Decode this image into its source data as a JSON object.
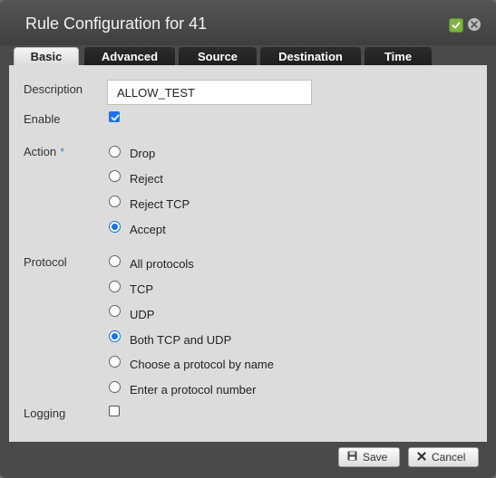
{
  "window": {
    "title": "Rule Configuration for 41",
    "apply_icon": "check-icon",
    "close_icon": "close-icon"
  },
  "tabs": [
    {
      "label": "Basic",
      "active": true
    },
    {
      "label": "Advanced",
      "active": false
    },
    {
      "label": "Source",
      "active": false
    },
    {
      "label": "Destination",
      "active": false
    },
    {
      "label": "Time",
      "active": false
    }
  ],
  "form": {
    "description": {
      "label": "Description",
      "value": "ALLOW_TEST"
    },
    "enable": {
      "label": "Enable",
      "checked": true
    },
    "action": {
      "label": "Action",
      "required_mark": "*",
      "options": [
        "Drop",
        "Reject",
        "Reject TCP",
        "Accept"
      ],
      "selected": "Accept"
    },
    "protocol": {
      "label": "Protocol",
      "options": [
        "All protocols",
        "TCP",
        "UDP",
        "Both TCP and UDP",
        "Choose a protocol by name",
        "Enter a protocol number"
      ],
      "selected": "Both TCP and UDP"
    },
    "logging": {
      "label": "Logging",
      "checked": false
    }
  },
  "footer": {
    "save_label": "Save",
    "cancel_label": "Cancel"
  },
  "colors": {
    "accent": "#1a73e8",
    "title_bar": "#4a4a4a",
    "panel": "#dcdcdc",
    "required_star": "#3a87d1"
  }
}
